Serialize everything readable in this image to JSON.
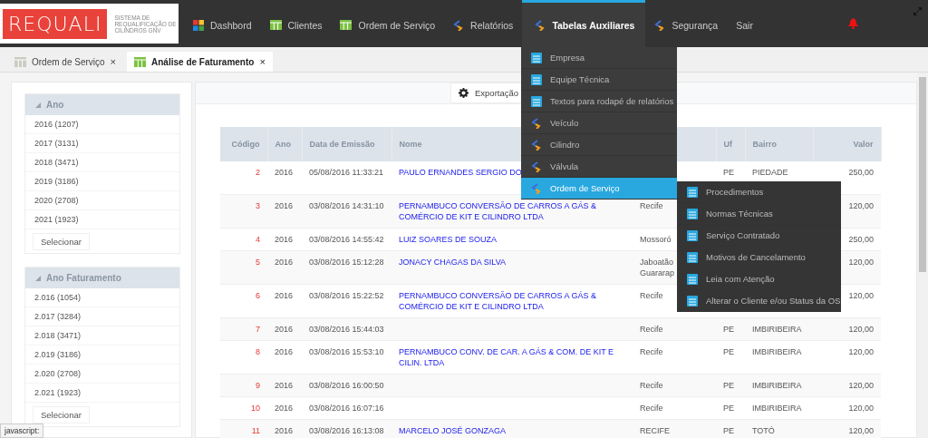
{
  "brand": {
    "name": "REQUALI",
    "subtitle": "SISTEMA DE REQUALIFICAÇÃO DE CILINDROS GNV"
  },
  "nav": [
    {
      "label": "Dashbord",
      "kind": "dashboard",
      "selected": false
    },
    {
      "label": "Clientes",
      "kind": "grid",
      "selected": false
    },
    {
      "label": "Ordem de Serviço",
      "kind": "grid",
      "selected": false
    },
    {
      "label": "Relatórios",
      "kind": "chevron",
      "selected": false
    },
    {
      "label": "Tabelas Auxiliares",
      "kind": "chevron",
      "selected": true
    },
    {
      "label": "Segurança",
      "kind": "chevron",
      "selected": false
    },
    {
      "label": "Sair",
      "kind": "plain",
      "selected": false
    }
  ],
  "tabs": [
    {
      "label": "Ordem de Serviço",
      "close": "×",
      "selected": false
    },
    {
      "label": "Análise de Faturamento",
      "close": "×",
      "selected": true
    }
  ],
  "filters": [
    {
      "title": "Ano",
      "expanded": true,
      "items": [
        "2016 (1207)",
        "2017 (3131)",
        "2018 (3471)",
        "2019 (3186)",
        "2020 (2708)",
        "2021 (1923)"
      ],
      "button": "Selecionar"
    },
    {
      "title": "Ano Faturamento",
      "expanded": true,
      "items": [
        "2.016 (1054)",
        "2.017 (3284)",
        "2.018 (3471)",
        "2.019 (3186)",
        "2.020 (2708)",
        "2.021 (1923)"
      ],
      "button": "Selecionar"
    }
  ],
  "toolbar": {
    "export_button": "Exportação"
  },
  "table": {
    "columns": [
      {
        "label": "Código"
      },
      {
        "label": "Ano"
      },
      {
        "label": "Data de Emissão"
      },
      {
        "label": "Nome"
      },
      {},
      {
        "label": "Uf"
      },
      {
        "label": "Bairro"
      },
      {
        "label": "Valor"
      }
    ],
    "rows": [
      {
        "codigo": "2",
        "ano": "2016",
        "data": "05/08/2016 11:33:21",
        "nome": "PAULO ERNANDES SERGIO DO",
        "uf": "PE",
        "bairro": "PIEDADE",
        "valor": "250,00"
      },
      {
        "codigo": "3",
        "ano": "2016",
        "data": "03/08/2016 14:31:10",
        "nome": "PERNAMBUCO CONVERSÃO DE CARROS A GÁS & COMÉRCIO DE KIT E CILINDRO LTDA",
        "column_5": "Recife",
        "valor": "120,00"
      },
      {
        "codigo": "4",
        "ano": "2016",
        "data": "03/08/2016 14:55:42",
        "nome": "LUIZ SOARES DE SOUZA",
        "column_5": "Mossoró",
        "valor": "250,00"
      },
      {
        "codigo": "5",
        "ano": "2016",
        "data": "03/08/2016 15:12:28",
        "nome": "JONACY CHAGAS DA SILVA",
        "column_5": "Jaboatão Guararap",
        "valor": "120,00"
      },
      {
        "codigo": "6",
        "ano": "2016",
        "data": "03/08/2016 15:22:52",
        "nome": "PERNAMBUCO CONVERSÃO DE CARROS A GÁS & COMÉRCIO DE KIT E CILINDRO LTDA",
        "column_5": "Recife",
        "valor": "120,00"
      },
      {
        "codigo": "7",
        "ano": "2016",
        "data": "03/08/2016 15:44:03",
        "column_5": "Recife",
        "uf": "PE",
        "bairro": "IMBIRIBEIRA",
        "valor": "120,00"
      },
      {
        "codigo": "8",
        "ano": "2016",
        "data": "03/08/2016 15:53:10",
        "nome": "PERNAMBUCO CONV. DE CAR. A GÁS & COM. DE KIT E CILIN. LTDA",
        "column_5": "Recife",
        "uf": "PE",
        "bairro": "IMBIRIBEIRA",
        "valor": "120,00"
      },
      {
        "codigo": "9",
        "ano": "2016",
        "data": "03/08/2016 16:00:50",
        "column_5": "Recife",
        "uf": "PE",
        "bairro": "IMBIRIBEIRA",
        "valor": "120,00"
      },
      {
        "codigo": "10",
        "ano": "2016",
        "data": "03/08/2016 16:07:16",
        "column_5": "Recife",
        "uf": "PE",
        "bairro": "IMBIRIBEIRA",
        "valor": "120,00"
      },
      {
        "codigo": "11",
        "ano": "2016",
        "data": "03/08/2016 16:13:08",
        "nome": "MARCELO JOSÉ GONZAGA",
        "column_5": "RECIFE",
        "uf": "PE",
        "bairro": "TOTÓ",
        "valor": "120,00"
      }
    ]
  },
  "menu": {
    "items": [
      {
        "label": "Empresa",
        "kind": "table",
        "selected": false
      },
      {
        "label": "Equipe Técnica",
        "kind": "table",
        "selected": false
      },
      {
        "label": "Textos para rodapé de relatórios",
        "kind": "table",
        "selected": false
      },
      {
        "label": "Veículo",
        "kind": "chevron",
        "selected": false
      },
      {
        "label": "Cilindro",
        "kind": "chevron",
        "selected": false
      },
      {
        "label": "Válvula",
        "kind": "chevron",
        "selected": false
      },
      {
        "label": "Ordem de Serviço",
        "kind": "chevron",
        "selected": true
      }
    ],
    "submenu": [
      "Procedimentos",
      "Normas Técnicas",
      "Serviço Contratado",
      "Motivos de Cancelamento",
      "Leia com Atenção",
      "Alterar o Cliente e/ou Status da OS"
    ]
  },
  "status_bar": "javascript:"
}
